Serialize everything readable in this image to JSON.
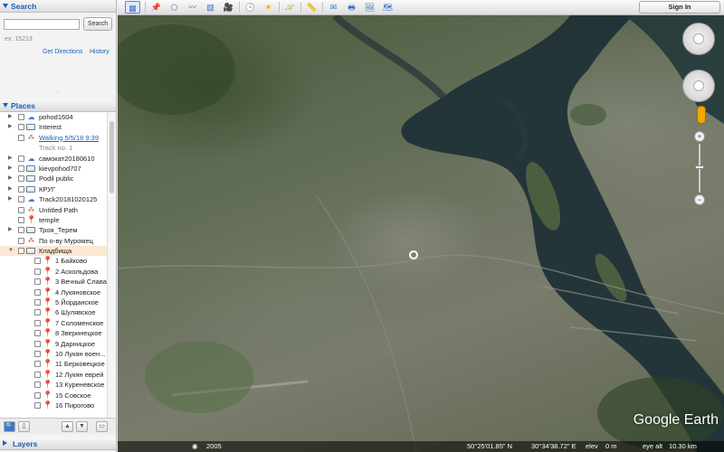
{
  "search": {
    "title": "Search",
    "input_value": "",
    "button_label": "Search",
    "hint": "ex: 15213",
    "get_directions": "Get Directions",
    "history": "History"
  },
  "places": {
    "title": "Places",
    "items": [
      {
        "label": "pohod1604",
        "icon": "kml-icon",
        "arrow": true
      },
      {
        "label": "Interest",
        "icon": "folder-icon",
        "arrow": true
      },
      {
        "label": "Walking 5/5/18 9:39",
        "icon": "path-icon",
        "arrow": false,
        "link": true
      },
      {
        "label": "Track no. 1",
        "icon": "none",
        "arrow": false,
        "dim": true
      },
      {
        "label": "самокат20180610",
        "icon": "kml-icon",
        "arrow": true
      },
      {
        "label": "kievpohod707",
        "icon": "folder-icon",
        "arrow": true
      },
      {
        "label": "Podil public",
        "icon": "folder-icon",
        "arrow": true
      },
      {
        "label": "КРУГ",
        "icon": "folder-icon",
        "arrow": true
      },
      {
        "label": "Track20181020125",
        "icon": "kml-icon",
        "arrow": true
      },
      {
        "label": "Untitled Path",
        "icon": "path-icon",
        "arrow": false
      },
      {
        "label": "temple",
        "icon": "pin-icon",
        "arrow": false
      },
      {
        "label": "Троя_Терем",
        "icon": "folder-icon",
        "arrow": true
      },
      {
        "label": "По о-ву Муромец",
        "icon": "path-icon",
        "arrow": false
      },
      {
        "label": "Кладбища",
        "icon": "folder-icon",
        "arrow": true,
        "selected": true
      },
      {
        "label": "1 Байково",
        "icon": "pin-icon",
        "sub": true
      },
      {
        "label": "2 Аскольдова",
        "icon": "pin-icon",
        "sub": true
      },
      {
        "label": "3 Вечный Слава",
        "icon": "pin-icon",
        "sub": true
      },
      {
        "label": "4 Лукяновское",
        "icon": "pin-icon",
        "sub": true
      },
      {
        "label": "5 Йорданское",
        "icon": "pin-icon",
        "sub": true
      },
      {
        "label": "6 Шулявское",
        "icon": "pin-icon",
        "sub": true
      },
      {
        "label": "7 Соломенское",
        "icon": "pin-icon",
        "sub": true
      },
      {
        "label": "8 Зверинецкое",
        "icon": "pin-icon",
        "sub": true
      },
      {
        "label": "9 Дарницкое",
        "icon": "pin-icon",
        "sub": true
      },
      {
        "label": "10 Лукян воен...",
        "icon": "pin-icon",
        "sub": true
      },
      {
        "label": "11 Берковецкое",
        "icon": "pin-icon",
        "sub": true
      },
      {
        "label": "12 Лукян еврей",
        "icon": "pin-icon",
        "sub": true
      },
      {
        "label": "13 Куреневское",
        "icon": "pin-icon",
        "sub": true
      },
      {
        "label": "15 Совское",
        "icon": "pin-icon",
        "sub": true
      },
      {
        "label": "16 Пирогово",
        "icon": "pin-icon",
        "sub": true
      }
    ]
  },
  "layers": {
    "title": "Layers"
  },
  "toolbar": {
    "sign_in": "Sign In"
  },
  "map": {
    "branding": "Google Earth",
    "year": "2005",
    "lat": "50°25'01.85\" N",
    "lon": "30°34'38.72\" E",
    "elev_label": "elev",
    "elev_value": "0 m",
    "eye_alt_label": "eye alt",
    "eye_alt_value": "10.30 km"
  },
  "colors": {
    "accent": "#1d5fb6",
    "selected_row": "#fbe7d4",
    "water": "#1c2e33"
  }
}
